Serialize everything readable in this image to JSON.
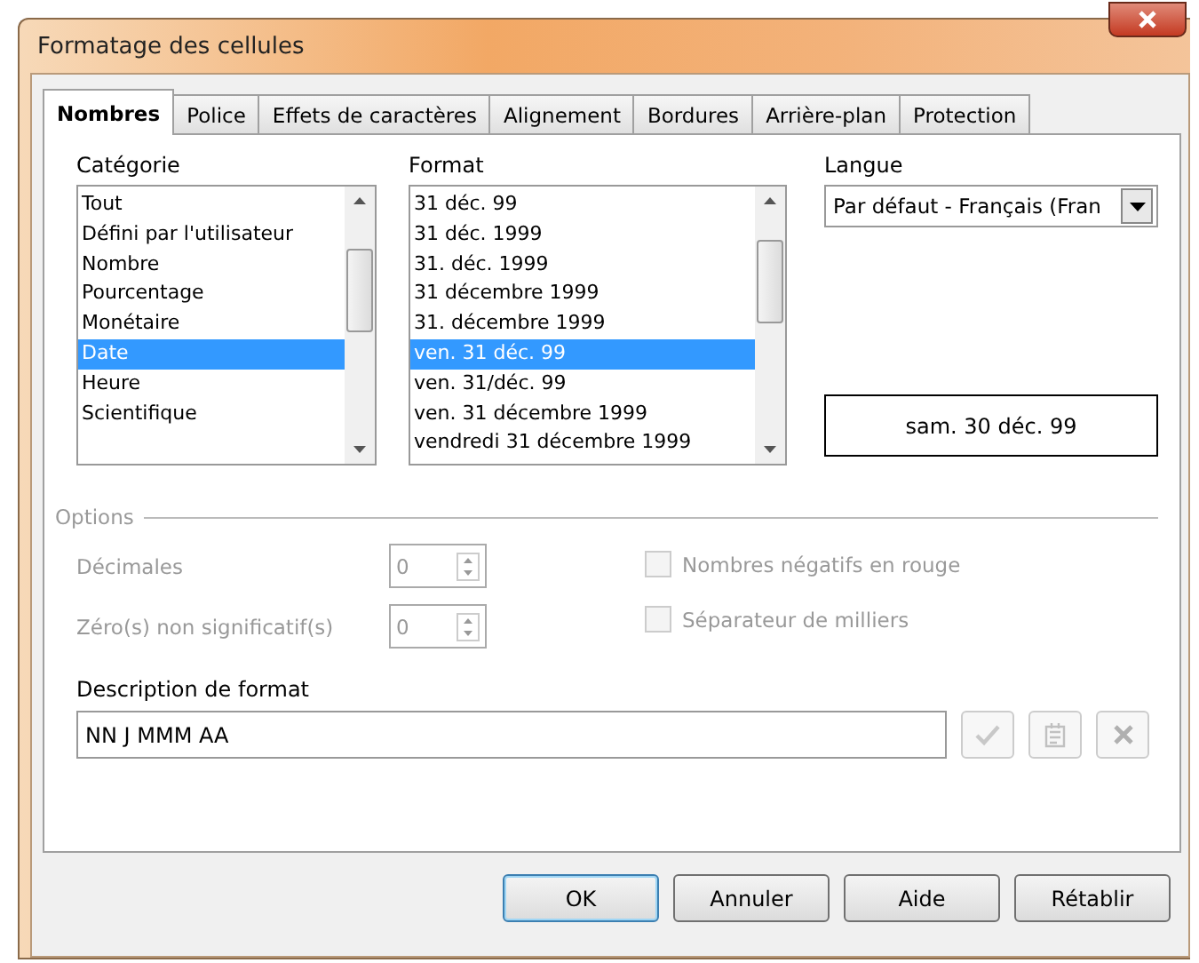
{
  "window": {
    "title": "Formatage des cellules"
  },
  "tabs": [
    {
      "label": "Nombres",
      "selected": true
    },
    {
      "label": "Police",
      "selected": false
    },
    {
      "label": "Effets de caractères",
      "selected": false
    },
    {
      "label": "Alignement",
      "selected": false
    },
    {
      "label": "Bordures",
      "selected": false
    },
    {
      "label": "Arrière-plan",
      "selected": false
    },
    {
      "label": "Protection",
      "selected": false
    }
  ],
  "category": {
    "label": "Catégorie",
    "items": [
      {
        "label": "Tout",
        "selected": false
      },
      {
        "label": "Défini par l'utilisateur",
        "selected": false
      },
      {
        "label": "Nombre",
        "selected": false
      },
      {
        "label": "Pourcentage",
        "selected": false
      },
      {
        "label": "Monétaire",
        "selected": false
      },
      {
        "label": "Date",
        "selected": true
      },
      {
        "label": "Heure",
        "selected": false
      },
      {
        "label": "Scientifique",
        "selected": false
      }
    ]
  },
  "format": {
    "label": "Format",
    "items": [
      {
        "label": "31 déc. 99",
        "selected": false
      },
      {
        "label": "31 déc. 1999",
        "selected": false
      },
      {
        "label": "31. déc. 1999",
        "selected": false
      },
      {
        "label": "31 décembre 1999",
        "selected": false
      },
      {
        "label": "31. décembre 1999",
        "selected": false
      },
      {
        "label": "ven. 31 déc. 99",
        "selected": true
      },
      {
        "label": "ven. 31/déc. 99",
        "selected": false
      },
      {
        "label": "ven. 31 décembre 1999",
        "selected": false
      },
      {
        "label": "vendredi 31 décembre 1999",
        "selected": false
      }
    ]
  },
  "language": {
    "label": "Langue",
    "value": "Par défaut - Français (Fran"
  },
  "preview": {
    "text": "sam. 30 déc. 99"
  },
  "options": {
    "heading": "Options",
    "fields": [
      {
        "label": "Décimales",
        "value": "0",
        "disabled": true
      },
      {
        "label": "Zéro(s) non significatif(s)",
        "value": "0",
        "disabled": true
      }
    ],
    "checkboxes": [
      {
        "label": "Nombres négatifs en rouge",
        "checked": false,
        "disabled": true
      },
      {
        "label": "Séparateur de milliers",
        "checked": false,
        "disabled": true
      }
    ]
  },
  "format_code": {
    "label": "Description de format",
    "value": "NN J MMM AA"
  },
  "buttons": [
    {
      "label": "OK",
      "default": true
    },
    {
      "label": "Annuler",
      "default": false
    },
    {
      "label": "Aide",
      "default": false
    },
    {
      "label": "Rétablir",
      "default": false
    }
  ]
}
